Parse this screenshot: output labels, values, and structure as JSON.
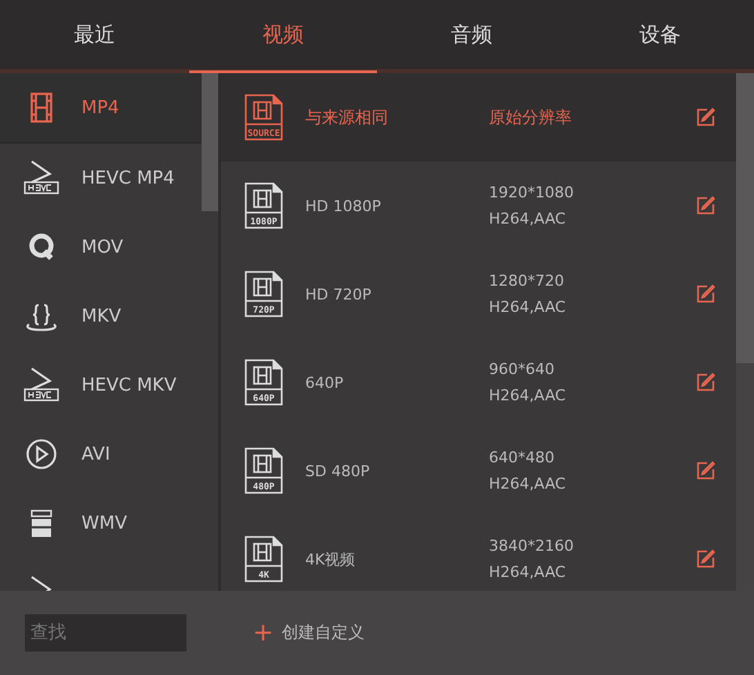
{
  "tabs": [
    {
      "label": "最近",
      "selected": false
    },
    {
      "label": "视频",
      "selected": true
    },
    {
      "label": "音频",
      "selected": false
    },
    {
      "label": "设备",
      "selected": false
    }
  ],
  "formats": [
    {
      "label": "MP4",
      "kind": "film",
      "selected": true
    },
    {
      "label": "HEVC MP4",
      "kind": "hevc",
      "selected": false
    },
    {
      "label": "MOV",
      "kind": "q",
      "selected": false
    },
    {
      "label": "MKV",
      "kind": "braces",
      "selected": false
    },
    {
      "label": "HEVC MKV",
      "kind": "hevc",
      "selected": false
    },
    {
      "label": "AVI",
      "kind": "play-circle",
      "selected": false
    },
    {
      "label": "WMV",
      "kind": "clapper",
      "selected": false
    },
    {
      "kind": "play",
      "selected": false
    }
  ],
  "presets": [
    {
      "badge": "SOURCE",
      "name": "与来源相同",
      "resolution": "原始分辨率",
      "selected": true
    },
    {
      "badge": "1080P",
      "name": "HD 1080P",
      "resolution": "1920*1080",
      "codec": "H264,AAC",
      "selected": false
    },
    {
      "badge": "720P",
      "name": "HD 720P",
      "resolution": "1280*720",
      "codec": "H264,AAC",
      "selected": false
    },
    {
      "badge": "640P",
      "name": "640P",
      "resolution": "960*640",
      "codec": "H264,AAC",
      "selected": false
    },
    {
      "badge": "480P",
      "name": "SD 480P",
      "resolution": "640*480",
      "codec": "H264,AAC",
      "selected": false
    },
    {
      "badge": "4K",
      "name": "4K视频",
      "resolution": "3840*2160",
      "codec": "H264,AAC",
      "selected": false
    }
  ],
  "search": {
    "placeholder": "查找"
  },
  "create_button": {
    "icon": "+",
    "label": "创建自定义"
  }
}
